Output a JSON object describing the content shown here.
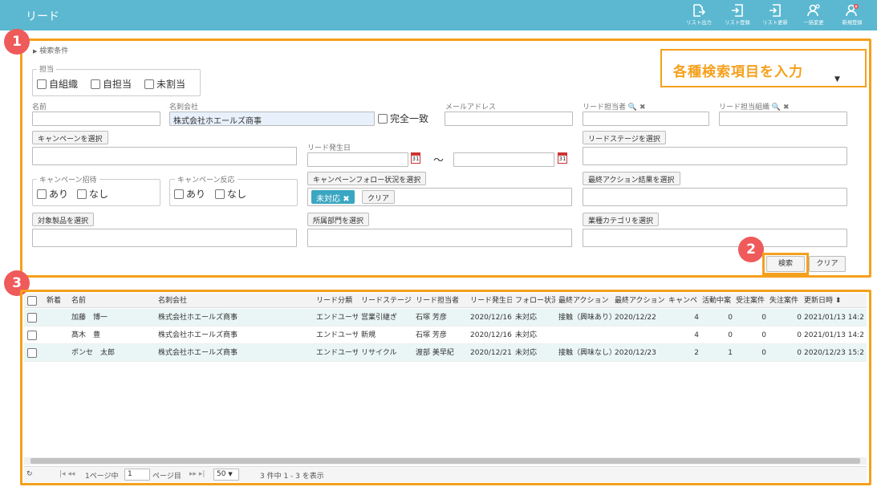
{
  "header": {
    "title": "リード",
    "buttons": [
      {
        "label": "リスト出力",
        "icon": "export-icon"
      },
      {
        "label": "リスト登録",
        "icon": "list-register-icon"
      },
      {
        "label": "リスト更新",
        "icon": "list-update-icon"
      },
      {
        "label": "一括変更",
        "icon": "bulk-change-icon"
      },
      {
        "label": "新規登録",
        "icon": "new-user-icon"
      }
    ]
  },
  "badges": {
    "one": "1",
    "two": "2",
    "three": "3"
  },
  "callout": "各種検索項目を入力",
  "search": {
    "title": "検索条件",
    "owner_group": {
      "legend": "担当",
      "opt1": "自組織",
      "opt2": "自担当",
      "opt3": "未割当"
    },
    "name_label": "名前",
    "company_label": "名刺会社",
    "company_value": "株式会社ホエールズ商事",
    "exact_match": "完全一致",
    "email_label": "メールアドレス",
    "lead_owner_label": "リード担当者",
    "lead_org_label": "リード担当組織",
    "campaign_btn": "キャンペーンを選択",
    "lead_date_label": "リード発生日",
    "tilde": "～",
    "lead_stage_btn": "リードステージを選択",
    "campaign_invite": {
      "legend": "キャンペーン招待",
      "yes": "あり",
      "no": "なし"
    },
    "campaign_response": {
      "legend": "キャンペーン反応",
      "yes": "あり",
      "no": "なし"
    },
    "follow_btn": "キャンペーンフォロー状況を選択",
    "follow_tag": "未対応",
    "clear_small": "クリア",
    "last_action_btn": "最終アクション結果を選択",
    "product_btn": "対象製品を選択",
    "dept_btn": "所属部門を選択",
    "industry_btn": "業種カテゴリを選択",
    "search_btn": "検索",
    "clear_btn": "クリア"
  },
  "table": {
    "columns": [
      "新着",
      "名前",
      "名刺会社",
      "リード分類",
      "リードステージ",
      "リード担当者",
      "リード発生日",
      "フォロー状況",
      "最終アクション",
      "最終アクション",
      "キャンペ",
      "活動中案",
      "受注案件",
      "失注案件",
      "更新日時"
    ],
    "rows": [
      [
        "",
        "加藤　博一",
        "株式会社ホエールズ商事",
        "エンドユーザ",
        "営業引継ぎ",
        "石塚 芳彦",
        "2020/12/16",
        "未対応",
        "接触（興味あり）",
        "2020/12/22",
        "4",
        "0",
        "0",
        "0",
        "2021/01/13 14:2"
      ],
      [
        "",
        "髙木　豊",
        "株式会社ホエールズ商事",
        "エンドユーザ",
        "新規",
        "石塚 芳彦",
        "2020/12/16",
        "未対応",
        "",
        "",
        "4",
        "0",
        "0",
        "0",
        "2021/01/13 14:2"
      ],
      [
        "",
        "ポンセ　太郎",
        "株式会社ホエールズ商事",
        "エンドユーザ",
        "リサイクル",
        "渡部 美早紀",
        "2020/12/21",
        "未対応",
        "接触（興味なし）",
        "2020/12/23",
        "2",
        "1",
        "0",
        "0",
        "2020/12/23 15:2"
      ]
    ]
  },
  "pager": {
    "page_prefix": "1ページ中",
    "page_value": "1",
    "page_suffix": "ページ目",
    "per_page": "50",
    "summary": "3 件中 1 - 3 を表示"
  },
  "colors": {
    "accent": "#f5a01c",
    "header": "#5bb8d0",
    "badge": "#ef5a5a",
    "tag": "#3aa6c2"
  }
}
